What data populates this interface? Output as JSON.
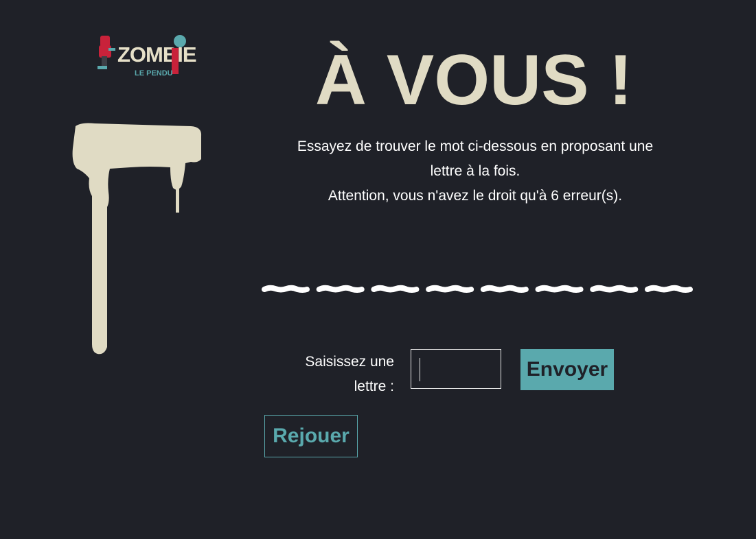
{
  "header": {
    "logo": {
      "main_text": "ZOMBIE",
      "sub_text": "LE PENDU",
      "colors": {
        "cream": "#e6e0c8",
        "teal": "#5aa9ad",
        "red": "#c8223a"
      }
    },
    "title": "À VOUS !"
  },
  "instructions": {
    "line1": "Essayez de trouver le mot ci-dessous en proposant une",
    "line2": "lettre à la fois.",
    "line3": "Attention, vous n'avez le droit qu'à 6 erreur(s)."
  },
  "word": {
    "letter_count": 8,
    "revealed": [
      "",
      "",
      "",
      "",
      "",
      "",
      "",
      ""
    ]
  },
  "form": {
    "label_line1": "Saisissez une",
    "label_line2": "lettre :",
    "input_value": "",
    "submit_label": "Envoyer"
  },
  "replay_label": "Rejouer",
  "colors": {
    "background": "#1f2128",
    "accent": "#5aa9ad",
    "cream": "#e0dbc4",
    "text": "#ffffff"
  }
}
